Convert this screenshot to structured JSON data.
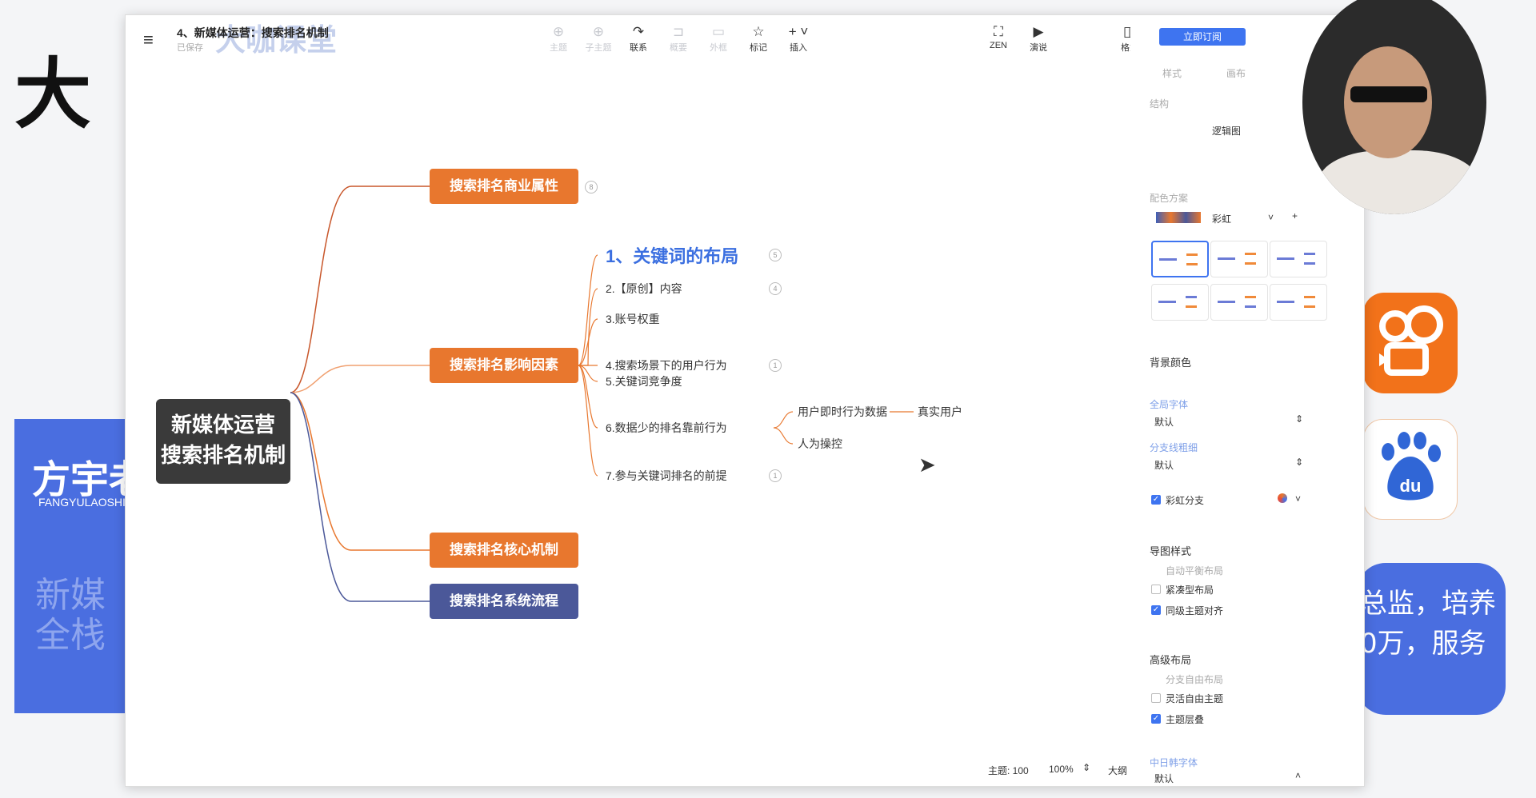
{
  "background": {
    "big_char": "大",
    "left_name": "方宇老",
    "left_sub": "FANGYULAOSHI",
    "left_dim": [
      "新媒",
      "全栈"
    ],
    "right_text": [
      "总监，培养",
      "0万，服务"
    ]
  },
  "header": {
    "title": "4、新媒体运营：搜索排名机制",
    "subtitle": "已保存",
    "watermark": "大咖课堂",
    "toolbar": [
      {
        "label": "主题",
        "icon": "⊕",
        "state": "dim"
      },
      {
        "label": "子主题",
        "icon": "⊕",
        "state": "dim"
      },
      {
        "label": "联系",
        "icon": "↷",
        "state": "act"
      },
      {
        "label": "概要",
        "icon": "⊐",
        "state": "dim"
      },
      {
        "label": "外框",
        "icon": "▭",
        "state": "dim"
      },
      {
        "label": "标记",
        "icon": "☆",
        "state": "act"
      },
      {
        "label": "插入",
        "icon": "+ ˅",
        "state": "act"
      },
      {
        "label": "ZEN",
        "icon": "⛶",
        "state": "act"
      },
      {
        "label": "演说",
        "icon": "▶",
        "state": "act"
      },
      {
        "label": "格式",
        "icon": "◫",
        "state": "act"
      }
    ]
  },
  "mindmap": {
    "root": [
      "新媒体运营",
      "搜索排名机制"
    ],
    "branches": [
      {
        "label": "搜索排名商业属性",
        "color": "#e8772e",
        "badge": "8"
      },
      {
        "label": "搜索排名影响因素",
        "color": "#e8772e",
        "badge": ""
      },
      {
        "label": "搜索排名核心机制",
        "color": "#e8772e",
        "badge": ""
      },
      {
        "label": "搜索排名系统流程",
        "color": "#4b5899",
        "badge": ""
      }
    ],
    "factors": [
      {
        "label": "1、关键词的布局",
        "badge": "5"
      },
      {
        "label": "2.【原创】内容",
        "badge": "4"
      },
      {
        "label": "3.账号权重",
        "badge": ""
      },
      {
        "label": "4.搜索场景下的用户行为",
        "badge": "1"
      },
      {
        "label": "5.关键词竞争度",
        "badge": ""
      },
      {
        "label": "6.数据少的排名靠前行为",
        "badge": ""
      },
      {
        "label": "7.参与关键词排名的前提",
        "badge": "1"
      }
    ],
    "sub6": [
      "用户即时行为数据",
      "人为操控"
    ],
    "sub6a": "真实用户"
  },
  "panel": {
    "subscribe": "立即订阅",
    "tabs": [
      "样式",
      "画布"
    ],
    "structure_label": "结构",
    "structure_value": "逻辑图",
    "scheme_label": "配色方案",
    "scheme_value": "彩虹",
    "bg_color_label": "背景颜色",
    "font_label": "全局字体",
    "font_value": "默认",
    "branch_label": "分支线粗细",
    "branch_value": "默认",
    "rainbow_label": "彩虹分支",
    "map_style_label": "导图样式",
    "map_style_sub": "自动平衡布局",
    "compact_label": "紧凑型布局",
    "align_label": "同级主题对齐",
    "adv_label": "高级布局",
    "adv_sub": "分支自由布局",
    "free_label": "灵活自由主题",
    "overlap_label": "主题层叠",
    "cn_font_label": "中日韩字体",
    "cn_font_value": "默认"
  },
  "status": {
    "topics": "主题: 100",
    "zoom": "100%",
    "outline": "大纲"
  }
}
